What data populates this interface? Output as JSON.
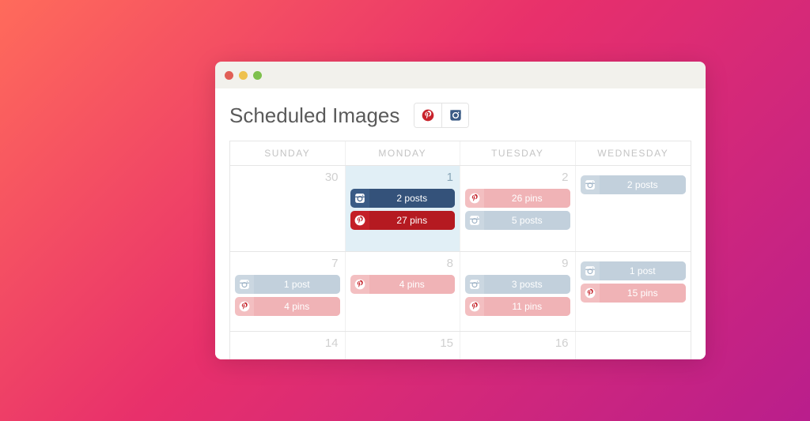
{
  "header": {
    "title": "Scheduled Images"
  },
  "calendar": {
    "days_of_week": [
      "SUNDAY",
      "MONDAY",
      "TUESDAY",
      "WEDNESDAY"
    ],
    "rows": [
      {
        "cells": [
          {
            "day": "30",
            "items": []
          },
          {
            "day": "1",
            "selected": true,
            "items": [
              {
                "kind": "instagram",
                "label": "2 posts",
                "active": true
              },
              {
                "kind": "pinterest",
                "label": "27 pins",
                "active": true
              }
            ]
          },
          {
            "day": "2",
            "items": [
              {
                "kind": "pinterest",
                "label": "26 pins",
                "active": false
              },
              {
                "kind": "instagram",
                "label": "5 posts",
                "active": false
              }
            ]
          },
          {
            "day": "",
            "items": [
              {
                "kind": "instagram",
                "label": "2 posts",
                "active": false
              }
            ]
          }
        ]
      },
      {
        "cells": [
          {
            "day": "7",
            "items": [
              {
                "kind": "instagram",
                "label": "1 post",
                "active": false
              },
              {
                "kind": "pinterest",
                "label": "4 pins",
                "active": false
              }
            ]
          },
          {
            "day": "8",
            "items": [
              {
                "kind": "pinterest",
                "label": "4 pins",
                "active": false
              }
            ]
          },
          {
            "day": "9",
            "items": [
              {
                "kind": "instagram",
                "label": "3 posts",
                "active": false
              },
              {
                "kind": "pinterest",
                "label": "11 pins",
                "active": false
              }
            ]
          },
          {
            "day": "",
            "items": [
              {
                "kind": "instagram",
                "label": "1 post",
                "active": false
              },
              {
                "kind": "pinterest",
                "label": "15 pins",
                "active": false
              }
            ]
          }
        ]
      },
      {
        "cells": [
          {
            "day": "14",
            "items": []
          },
          {
            "day": "15",
            "items": []
          },
          {
            "day": "16",
            "items": []
          },
          {
            "day": "",
            "items": []
          }
        ]
      }
    ]
  }
}
